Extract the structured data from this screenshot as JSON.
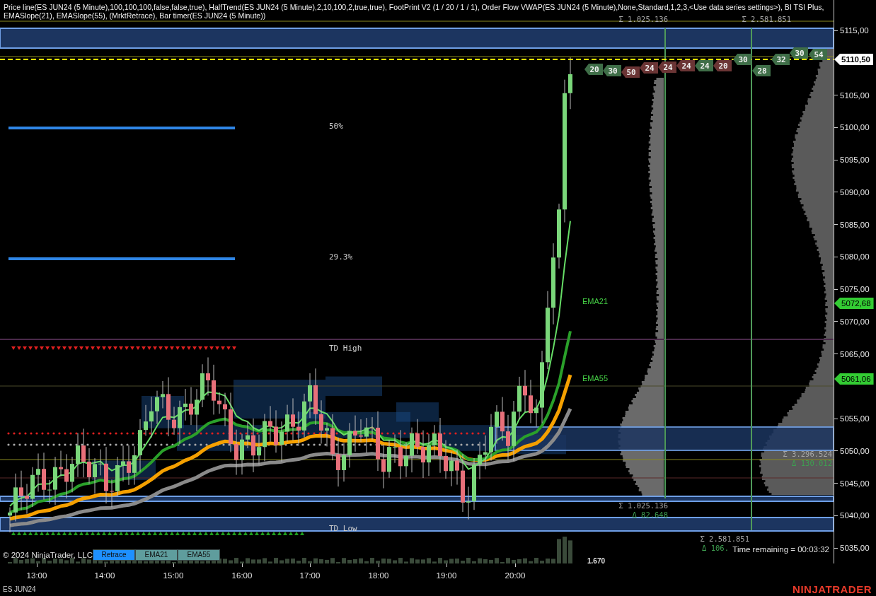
{
  "header": {
    "lines": [
      "Price line(ES JUN24 (5 Minute),100,100,100,false,false,true), HalfTrend(ES JUN24 (5 Minute),2,10,100,2,true,true), FootPrint V2 (1 / 20 / 1 / 1), Order Flow VWAP(ES JUN24 (5 Minute),None,Standard,1,2,3,<Use data series settings>), BI TSI Plus,",
      "EMASlope(21), EMASlope(55),  (MrktRetrace), Bar timer(ES JUN24 (5 Minute))"
    ]
  },
  "chart_labels": [
    {
      "text": "50%",
      "kind": "level"
    },
    {
      "text": "29.3%",
      "kind": "level"
    },
    {
      "text": "TD High",
      "kind": "level"
    },
    {
      "text": "TD Low",
      "kind": "level"
    },
    {
      "text": "EMA21",
      "kind": "ema"
    },
    {
      "text": "EMA55",
      "kind": "ema"
    }
  ],
  "footprint_badges": [
    {
      "value": "20",
      "color": "#3f6e48"
    },
    {
      "value": "30",
      "color": "#3f6e48"
    },
    {
      "value": "50",
      "color": "#6b3535"
    },
    {
      "value": "24",
      "color": "#6b3535"
    },
    {
      "value": "24",
      "color": "#6b3535"
    },
    {
      "value": "24",
      "color": "#6b3535"
    },
    {
      "value": "24",
      "color": "#3f6e48"
    },
    {
      "value": "20",
      "color": "#6b3535"
    },
    {
      "value": "30",
      "color": "#3f6e48"
    },
    {
      "value": "28",
      "color": "#3f6e48"
    },
    {
      "value": "32",
      "color": "#3f6e48"
    },
    {
      "value": "30",
      "color": "#3f6e48"
    },
    {
      "value": "54",
      "color": "#3f6e48"
    }
  ],
  "profile_stats": [
    {
      "sum": "Σ 1.025.136"
    },
    {
      "sum": "Σ 2.581.851"
    },
    {
      "sum": "Σ 3.296.524",
      "delta": "Δ 130.012"
    },
    {
      "sum": "Σ 1.025.136",
      "delta": "Δ 82.648"
    },
    {
      "sum": "Σ 2.581.851",
      "delta": "Δ 106."
    }
  ],
  "volume_label": "1.670",
  "copyright": "© 2024 NinjaTrader, LLC",
  "buttons": [
    {
      "label": "Retrace",
      "selected": true
    },
    {
      "label": "EMA21",
      "selected": false
    },
    {
      "label": "EMA55",
      "selected": false
    }
  ],
  "time_remaining": "Time remaining = 00:03:32",
  "price_axis": {
    "labels": [
      "5115,00",
      "5105,00",
      "5100,00",
      "5095,00",
      "5090,00",
      "5085,00",
      "5080,00",
      "5075,00",
      "5070,00",
      "5065,00",
      "5055,00",
      "5050,00",
      "5045,00",
      "5040,00",
      "5035,00"
    ],
    "markers": [
      {
        "label": "5110,50",
        "kind": "last"
      },
      {
        "label": "5072,68",
        "kind": "ema"
      },
      {
        "label": "5061,06",
        "kind": "ema"
      }
    ]
  },
  "time_axis": {
    "labels": [
      "13:00",
      "14:00",
      "15:00",
      "16:00",
      "17:00",
      "18:00",
      "19:00",
      "20:00"
    ]
  },
  "instrument": "ES JUN24",
  "logo": "NINJATRADER"
}
